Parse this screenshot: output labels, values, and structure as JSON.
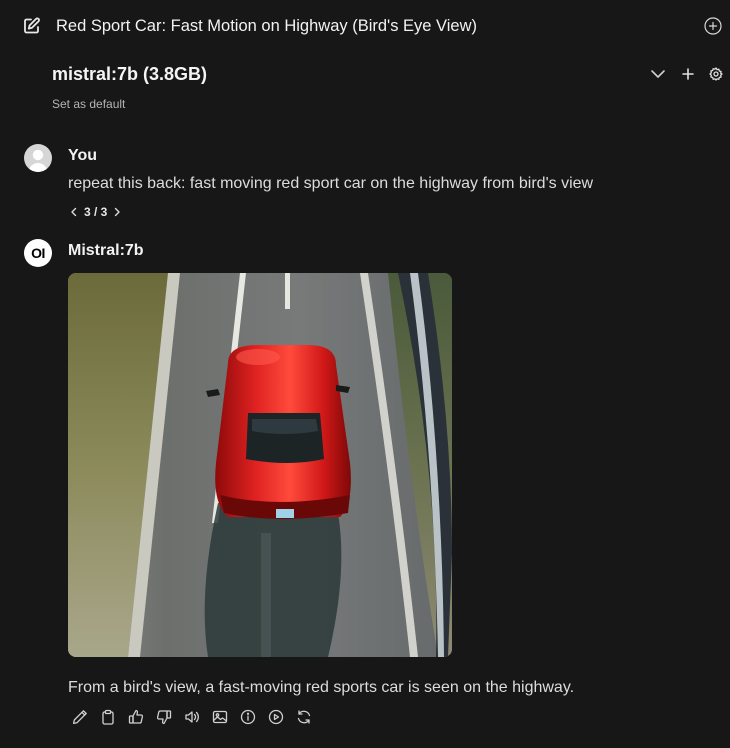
{
  "header": {
    "title": "Red Sport Car: Fast Motion on Highway (Bird's Eye View)",
    "edit_icon": "pencil-square-icon",
    "new_chat_icon": "plus-circle-icon"
  },
  "model_selector": {
    "model": "mistral:7b (3.8GB)",
    "set_default": "Set as default",
    "dropdown_icon": "chevron-down-icon",
    "add_icon": "plus-icon",
    "settings_icon": "gear-icon"
  },
  "messages": [
    {
      "sender": "You",
      "text": "repeat this back: fast moving red sport car on the highway from bird's view",
      "pager": "3 / 3"
    },
    {
      "sender": "Mistral:7b",
      "avatar_text": "OI",
      "image_alt": "red sports car on highway from above",
      "text": "From a bird's view, a fast-moving red sports car is seen on the highway."
    }
  ],
  "actions": [
    "edit-icon",
    "copy-icon",
    "thumbs-up-icon",
    "thumbs-down-icon",
    "speaker-icon",
    "image-icon",
    "info-icon",
    "play-icon",
    "regenerate-icon"
  ],
  "colors": {
    "background": "#171717",
    "text": "#ececec",
    "muted": "#b4b4b4",
    "car_red": "#d21818"
  }
}
